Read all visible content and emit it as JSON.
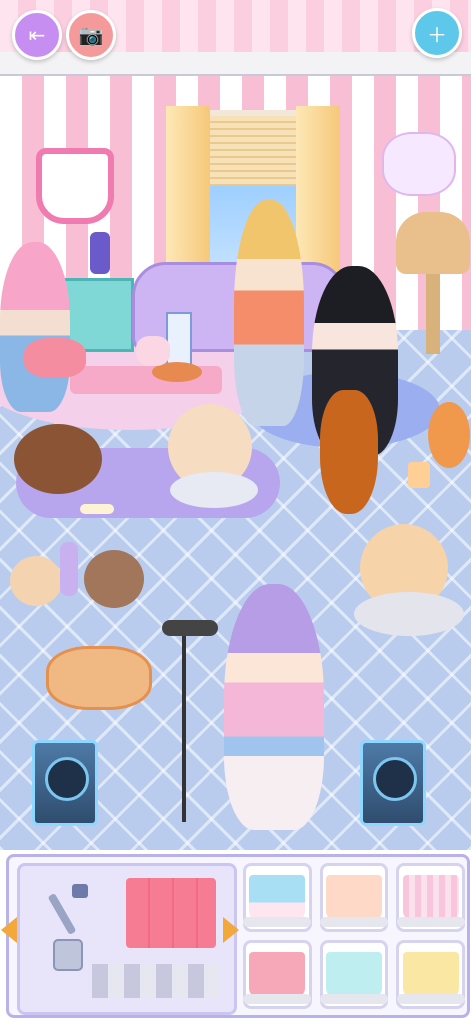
{
  "toolbar": {
    "exit_icon": "exit-door-icon",
    "camera_icon": "camera-icon",
    "add_furniture_icon": "add-furniture-icon",
    "accent_color": "#c7a4f2"
  },
  "scene": {
    "wall_colors": [
      "#ffffff",
      "#f8bfd4"
    ],
    "floor_color": "#b9ccee"
  },
  "editor": {
    "category_icon": "wallpaper-paint-icon",
    "prev_arrow_icon": "arrow-left-icon",
    "next_arrow_icon": "arrow-right-icon",
    "swatches": [
      {
        "icon": "wallpaper-roll-icon",
        "color": "#a9dff5",
        "accent": "#fde6ef"
      },
      {
        "icon": "wallpaper-roll-icon",
        "color": "#ffd9c8",
        "accent": "#ffffff"
      },
      {
        "icon": "wallpaper-roll-icon",
        "color": "#f8c5dc",
        "accent": "#fbe1ec"
      },
      {
        "icon": "wallpaper-roll-icon",
        "color": "#f6a7b8",
        "accent": "#f39ab0"
      },
      {
        "icon": "wallpaper-roll-icon",
        "color": "#bfeef0",
        "accent": "#e9f9fb"
      },
      {
        "icon": "wallpaper-roll-icon",
        "color": "#fbe7a4",
        "accent": "#fff4cc"
      }
    ]
  }
}
